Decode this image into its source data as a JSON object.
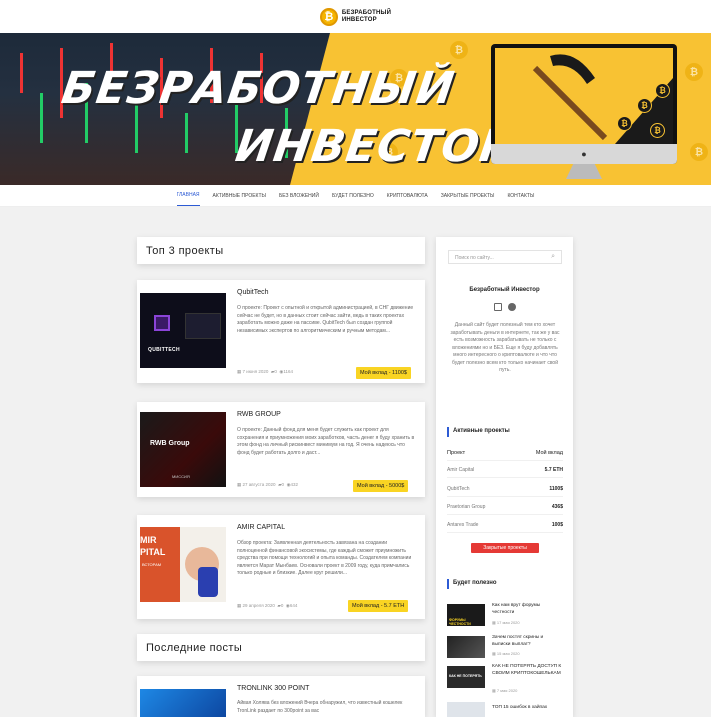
{
  "site": {
    "logo_text_line1": "БЕЗРАБОТНЫЙ",
    "logo_text_line2": "ИНВЕСТОР",
    "logo_symbol": "₿"
  },
  "banner": {
    "title_line1": "БЕЗРАБОТНЫЙ",
    "title_line2": "ИНВЕСТОР",
    "coin_symbol": "₿"
  },
  "nav": {
    "items": [
      "ГЛАВНАЯ",
      "АКТИВНЫЕ ПРОЕКТЫ",
      "БЕЗ ВЛОЖЕНИЙ",
      "БУДЕТ ПОЛЕЗНО",
      "КРИПТОВАЛЮТА",
      "ЗАКРЫТЫЕ ПРОЕКТЫ",
      "КОНТАКТЫ"
    ],
    "active_index": 0
  },
  "top3": {
    "heading": "Топ 3 проекты",
    "posts": [
      {
        "title": "QubitTech",
        "excerpt": "О проекте: Проект с опытной и открытой администрацией, в СНГ движение сейчас не будет, но в данных стоит сейчас зайти, ведь в таких проектах заработать можно даже на пассиве. QubitTech был создан группой независимых экспертов по алгоритмическим и ручным методам...",
        "date": "7 июня 2020",
        "comments": "0",
        "views": "1164",
        "deposit": "Мой вклад - 1100$",
        "thumb_text": "QUBITTECH"
      },
      {
        "title": "RWB GROUP",
        "excerpt": "О проекте: Данный фонд для меня будет служить как проект для сохранения и приумножения моих заработков, часть денег я буду хранить в этом фонд на личный рискинвест минимум на год. Я очень надеюсь что фонд будет работать долго и даст...",
        "date": "27 августа 2020",
        "comments": "0",
        "views": "432",
        "deposit": "Мой вклад - 5000$",
        "thumb_text": "RWB Group",
        "thumb_sub": "МИССИЯ"
      },
      {
        "title": "AMIR CAPITAL",
        "excerpt": "Обзор проекта: Заявленная деятельность завязана на создании полноценной финансовой экосистемы, где каждый сможет приумножить средства при помощи технологий и опыта команды. Создателем компании является Марат Мынбаев. Основали проект в 2009 году, куда примчались только родные и близкие. Далее круг решили...",
        "date": "29 апреля 2020",
        "comments": "0",
        "views": "644",
        "deposit": "Мой вклад - 5.7 ETH",
        "thumb_text": "MIR",
        "thumb_text2": "PITAL",
        "thumb_sub": "ВСТОРАМ"
      }
    ]
  },
  "latest": {
    "heading": "Последние посты",
    "posts": [
      {
        "title": "TRONLINK 300 POINT",
        "excerpt": "Айвая Холява без вложений Вчера обнаружил, что известный кошелек TronLink раздает по 300point за вас"
      }
    ]
  },
  "sidebar": {
    "search_placeholder": "Поиск по сайту...",
    "about": {
      "title": "Безработный Инвестор",
      "text": "Данный сайт будет полезный тем кто хочет заработывать деньги в интернете, так же у вас есть возможность зарабатывать не только с вложениями но и БЕЗ. Еще я буду добавлять много интересного о криптовалюте и что что будет полезно всем кто только начинает свой путь."
    },
    "active": {
      "heading": "Активные проекты",
      "col_project": "Проект",
      "col_deposit": "Мой вклад",
      "rows": [
        {
          "name": "Amir Capital",
          "value": "5.7 ETH"
        },
        {
          "name": "QubitTech",
          "value": "1100$"
        },
        {
          "name": "Praetorian Group",
          "value": "436$"
        },
        {
          "name": "Antares Trade",
          "value": "100$"
        }
      ],
      "closed_button": "Закрытые проекты"
    },
    "useful": {
      "heading": "Будет полезно",
      "items": [
        {
          "title": "Как нам врут форумы честности",
          "date": "17 мая 2020",
          "thumb": "ФОРУМЫ ЧЕСТНОСТИ"
        },
        {
          "title": "Зачем постят скрины и выписки выплат?",
          "date": "15 мая 2020",
          "thumb": ""
        },
        {
          "title": "КАК НЕ ПОТЕРЯТЬ ДОСТУП К СВОИМ КРИПТОКОШЕЛЬКАМ",
          "date": "7 мая 2020",
          "thumb": "КАК НЕ ПОТЕРЯТЬ"
        },
        {
          "title": "ТОП 15 ошибок в хайпах",
          "date": "",
          "thumb": ""
        }
      ]
    }
  },
  "colors": {
    "accent_blue": "#2d5bd4",
    "badge_yellow": "#f9d423",
    "button_red": "#e53935",
    "banner_yellow": "#f8c233"
  }
}
